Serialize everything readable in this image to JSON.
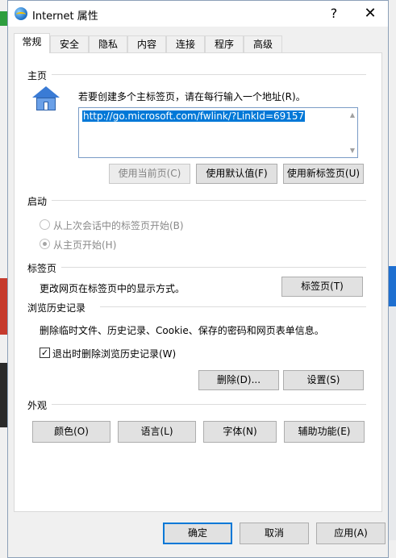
{
  "window": {
    "title": "Internet 属性",
    "help_glyph": "?",
    "close_glyph": "✕"
  },
  "tabs": [
    {
      "label": "常规",
      "active": true
    },
    {
      "label": "安全"
    },
    {
      "label": "隐私"
    },
    {
      "label": "内容"
    },
    {
      "label": "连接"
    },
    {
      "label": "程序"
    },
    {
      "label": "高级"
    }
  ],
  "homepage": {
    "section_title": "主页",
    "description": "若要创建多个主标签页，请在每行输入一个地址(R)。",
    "url": "http://go.microsoft.com/fwlink/?LinkId=69157",
    "use_current": "使用当前页(C)",
    "use_default": "使用默认值(F)",
    "use_new_tab": "使用新标签页(U)"
  },
  "startup": {
    "section_title": "启动",
    "option_last_session": "从上次会话中的标签页开始(B)",
    "option_home": "从主页开始(H)",
    "selected": "home"
  },
  "tabs_section": {
    "section_title": "标签页",
    "description": "更改网页在标签页中的显示方式。",
    "button": "标签页(T)"
  },
  "history": {
    "section_title": "浏览历史记录",
    "description": "删除临时文件、历史记录、Cookie、保存的密码和网页表单信息。",
    "checkbox_label": "退出时删除浏览历史记录(W)",
    "checkbox_checked": true,
    "check_glyph": "✓",
    "delete_button": "删除(D)...",
    "settings_button": "设置(S)"
  },
  "appearance": {
    "section_title": "外观",
    "colors": "颜色(O)",
    "languages": "语言(L)",
    "fonts": "字体(N)",
    "accessibility": "辅助功能(E)"
  },
  "footer": {
    "ok": "确定",
    "cancel": "取消",
    "apply": "应用(A)"
  }
}
